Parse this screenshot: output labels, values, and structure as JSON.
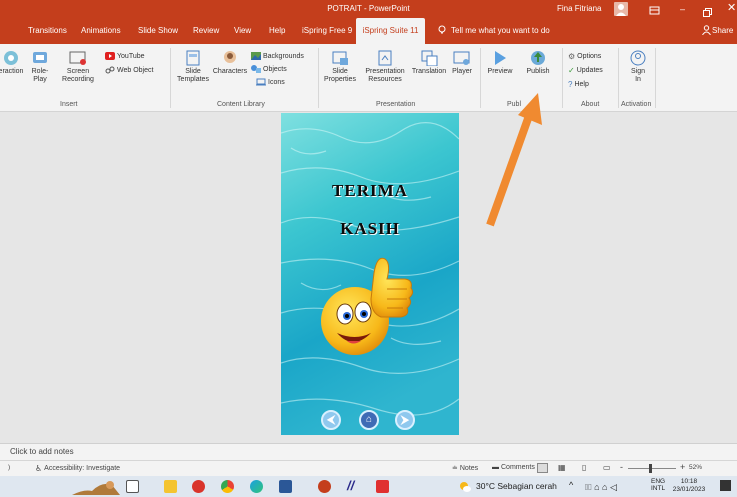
{
  "titlebar": {
    "title": "POTRAIT - PowerPoint",
    "user": "Fina Fitriana"
  },
  "tabs": [
    "Transitions",
    "Animations",
    "Slide Show",
    "Review",
    "View",
    "Help",
    "iSpring Free 9",
    "iSpring Suite 11"
  ],
  "tell_me": "Tell me what you want to do",
  "share": "Share",
  "ribbon": {
    "insert": {
      "interaction": "eraction",
      "roleplay": "Role-\nPlay",
      "screen": "Screen\nRecording",
      "youtube": "YouTube",
      "webobject": "Web Object",
      "label": "Insert"
    },
    "content": {
      "slide_templates": "Slide\nTemplates",
      "characters": "Characters",
      "backgrounds": "Backgrounds",
      "objects": "Objects",
      "icons": "Icons",
      "label": "Content Library"
    },
    "presentation": {
      "slide_properties": "Slide\nProperties",
      "resources": "Presentation\nResources",
      "translation": "Translation",
      "player": "Player",
      "label": "Presentation"
    },
    "publish": {
      "preview": "Preview",
      "publish": "Publish",
      "label": "Publ"
    },
    "about": {
      "options": "Options",
      "updates": "Updates",
      "help": "Help",
      "label": "About"
    },
    "activation": {
      "sign_in": "Sign\nIn",
      "label": "Activation"
    }
  },
  "slide": {
    "line1": "TERIMA",
    "line2": "KASIH"
  },
  "notes_placeholder": "Click to add notes",
  "status": {
    "accessibility": "Accessibility: Investigate",
    "notes": "Notes",
    "comments": "Comments",
    "zoom": "52%"
  },
  "taskbar": {
    "weather": "30°C  Sebagian cerah",
    "lang1": "ENG",
    "lang2": "INTL",
    "time": "10:18",
    "date": "23/01/2023"
  },
  "colors": {
    "accent": "#c43e1c",
    "arrow": "#f08a30"
  }
}
